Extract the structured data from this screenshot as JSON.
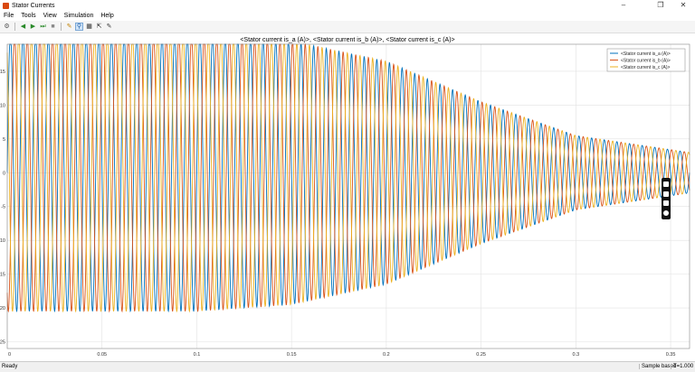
{
  "window": {
    "title": "Stator Currents"
  },
  "menu": [
    "File",
    "Tools",
    "View",
    "Simulation",
    "Help"
  ],
  "toolbar": {
    "icons": [
      "gear-icon",
      "back-icon",
      "run-icon",
      "step-forward-icon",
      "stop-icon",
      "highlight-icon",
      "zoom-icon",
      "fit-icon",
      "cursor-icon",
      "edit-icon"
    ]
  },
  "status": {
    "left": "Ready",
    "mode": "Sample based",
    "time": "T=1.000"
  },
  "chart_data": {
    "type": "line",
    "title": "<Stator current is_a (A)>, <Stator current is_b (A)>, <Stator current is_c (A)>",
    "xlim": [
      0,
      0.36
    ],
    "ylim": [
      -26,
      19
    ],
    "xticks": [
      0,
      0.05,
      0.1,
      0.15,
      0.2,
      0.25,
      0.3,
      0.35
    ],
    "xtick_labels": [
      "0",
      "0.05",
      "0.1",
      "0.15",
      "0.2",
      "0.25",
      "0.3",
      "0.35"
    ],
    "yticks": [
      -25,
      -20,
      -15,
      -10,
      -5,
      0,
      5,
      10,
      15
    ],
    "ytick_labels": [
      "-25",
      "-20",
      "-15",
      "-10",
      "-5",
      "0",
      "5",
      "10",
      "15"
    ],
    "grid": true,
    "legend_position": "top-right",
    "frequency_hz": 150,
    "envelope": {
      "t": [
        0,
        0.1,
        0.15,
        0.2,
        0.25,
        0.3,
        0.36
      ],
      "amplitude": [
        20.5,
        20.5,
        19.5,
        16.5,
        10.5,
        5.5,
        3
      ]
    },
    "series": [
      {
        "name": "<Stator current is_a (A)>",
        "color": "#0072BD",
        "phase_deg": 0
      },
      {
        "name": "<Stator current is_b (A)>",
        "color": "#D95319",
        "phase_deg": -120
      },
      {
        "name": "<Stator current is_c (A)>",
        "color": "#EDB120",
        "phase_deg": 120
      }
    ]
  }
}
